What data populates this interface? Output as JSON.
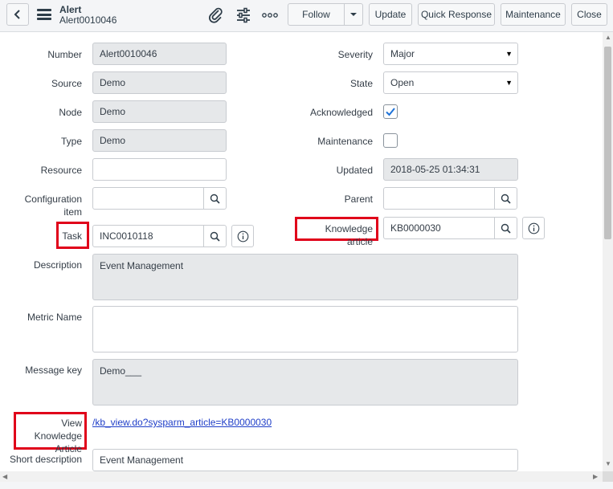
{
  "header": {
    "title": "Alert",
    "subtitle": "Alert0010046",
    "buttons": {
      "follow": "Follow",
      "update": "Update",
      "quick_response": "Quick Response",
      "maintenance": "Maintenance",
      "close": "Close"
    },
    "icons": [
      "chevron-left-icon",
      "hamburger-icon",
      "paperclip-icon",
      "sliders-icon",
      "more-icon",
      "caret-down-icon"
    ]
  },
  "form": {
    "number": {
      "label": "Number",
      "value": "Alert0010046"
    },
    "source": {
      "label": "Source",
      "value": "Demo"
    },
    "node": {
      "label": "Node",
      "value": "Demo"
    },
    "type": {
      "label": "Type",
      "value": "Demo"
    },
    "resource": {
      "label": "Resource",
      "value": ""
    },
    "configuration_item": {
      "label": "Configuration item",
      "value": ""
    },
    "task": {
      "label": "Task",
      "value": "INC0010118"
    },
    "description": {
      "label": "Description",
      "value": "Event Management"
    },
    "metric_name": {
      "label": "Metric Name",
      "value": ""
    },
    "message_key": {
      "label": "Message key",
      "value": "Demo___"
    },
    "view_knowledge_article": {
      "label": "View Knowledge Article",
      "value": "/kb_view.do?sysparm_article=KB0000030"
    },
    "short_description": {
      "label": "Short description",
      "value": "Event Management"
    },
    "severity": {
      "label": "Severity",
      "value": "Major"
    },
    "state": {
      "label": "State",
      "value": "Open"
    },
    "acknowledged": {
      "label": "Acknowledged",
      "checked": true
    },
    "maintenance": {
      "label": "Maintenance",
      "checked": false
    },
    "updated": {
      "label": "Updated",
      "value": "2018-05-25 01:34:31"
    },
    "parent": {
      "label": "Parent",
      "value": ""
    },
    "knowledge_article": {
      "label": "Knowledge article",
      "value": "KB0000030"
    }
  },
  "colors": {
    "highlight": "#e0001a",
    "link": "#1f3ec8",
    "check": "#1f73d8"
  }
}
